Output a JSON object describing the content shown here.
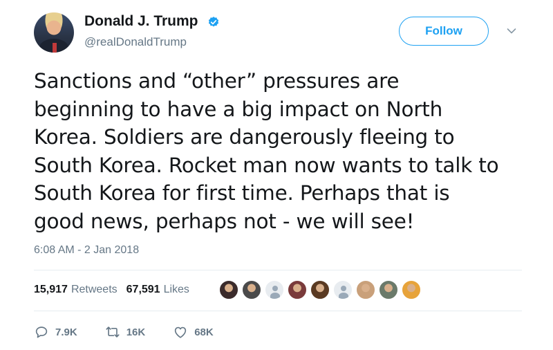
{
  "header": {
    "display_name": "Donald J. Trump",
    "handle": "@realDonaldTrump",
    "follow_label": "Follow",
    "verified_color": "#1da1f2",
    "icons": [
      "verified-badge-icon",
      "chevron-down-icon"
    ]
  },
  "tweet": {
    "lines": [
      "Sanctions and “other” pressures are",
      "beginning to have a big impact on North",
      "Korea. Soldiers are dangerously fleeing to",
      "South Korea. Rocket man now wants to talk to",
      "South Korea for first time. Perhaps that is",
      "good news, perhaps not - we will see!"
    ],
    "timestamp": "6:08 AM - 2 Jan 2018"
  },
  "stats": {
    "retweets_count": "15,917",
    "retweets_label": "Retweets",
    "likes_count": "67,591",
    "likes_label": "Likes"
  },
  "likers": [
    {
      "icon": "avatar",
      "color": "#3b2b2b"
    },
    {
      "icon": "avatar",
      "color": "#4a4a4a"
    },
    {
      "icon": "default-avatar-icon",
      "color": "#e8ecf0"
    },
    {
      "icon": "avatar",
      "color": "#7a3b3b"
    },
    {
      "icon": "avatar",
      "color": "#5a3a22"
    },
    {
      "icon": "default-avatar-icon",
      "color": "#e8ecf0"
    },
    {
      "icon": "avatar",
      "color": "#c9a07a"
    },
    {
      "icon": "avatar",
      "color": "#6b7a6a"
    },
    {
      "icon": "avatar",
      "color": "#e7a33a"
    }
  ],
  "actions": {
    "reply_count": "7.9K",
    "retweet_count": "16K",
    "like_count": "68K",
    "accent": "#657786"
  }
}
